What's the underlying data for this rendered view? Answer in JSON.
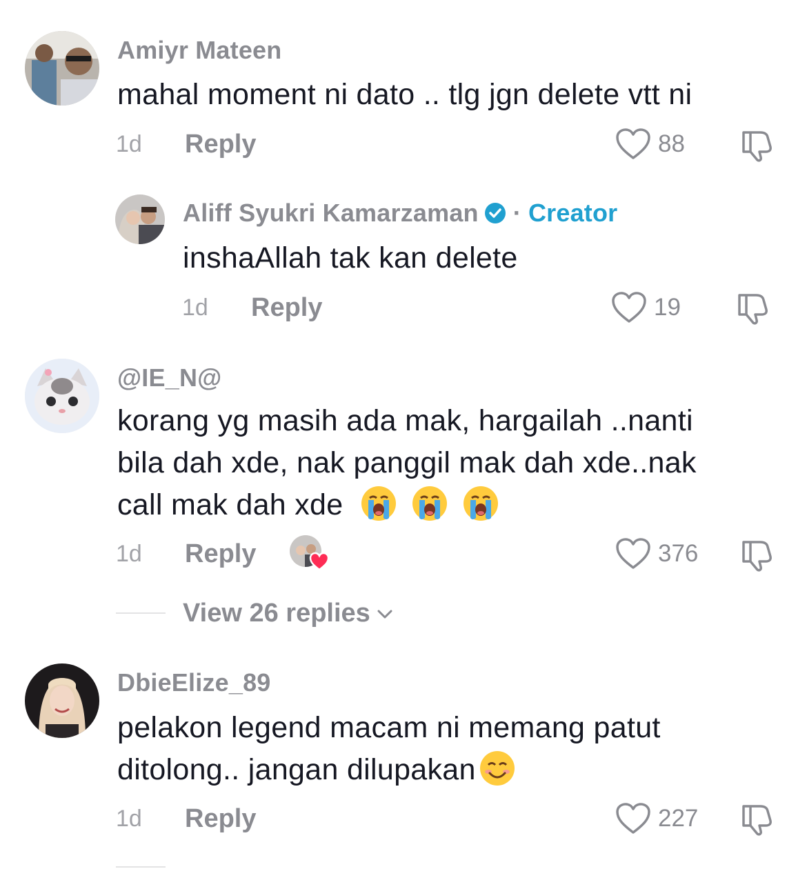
{
  "comments": [
    {
      "username": "Amiyr Mateen",
      "text": "mahal moment ni dato .. tlg jgn delete vtt ni",
      "time": "1d",
      "reply_label": "Reply",
      "likes": "88"
    },
    {
      "username": "Aliff Syukri Kamarzaman",
      "verified": true,
      "separator": "·",
      "badge": "Creator",
      "text": "inshaAllah tak kan delete",
      "time": "1d",
      "reply_label": "Reply",
      "likes": "19"
    },
    {
      "username": "@IE_N@",
      "text_lines": [
        "korang yg masih ada mak, hargailah ..nanti",
        "bila dah xde, nak panggil mak dah xde..nak",
        "call mak dah xde"
      ],
      "emoji": [
        "loudly-crying-face",
        "loudly-crying-face",
        "loudly-crying-face"
      ],
      "time": "1d",
      "reply_label": "Reply",
      "liked_by_creator": true,
      "likes": "376",
      "view_replies": "View 26 replies"
    },
    {
      "username": "DbieElize_89",
      "text_lines": [
        "pelakon legend macam ni memang patut",
        "ditolong.. jangan dilupakan"
      ],
      "emoji": [
        "smiling-face-with-smiling-eyes"
      ],
      "time": "1d",
      "reply_label": "Reply",
      "likes": "227"
    }
  ],
  "colors": {
    "meta_gray": "#8a8b91",
    "creator_blue": "#20a0d0",
    "creator_like_heart": "#fe2c55"
  }
}
